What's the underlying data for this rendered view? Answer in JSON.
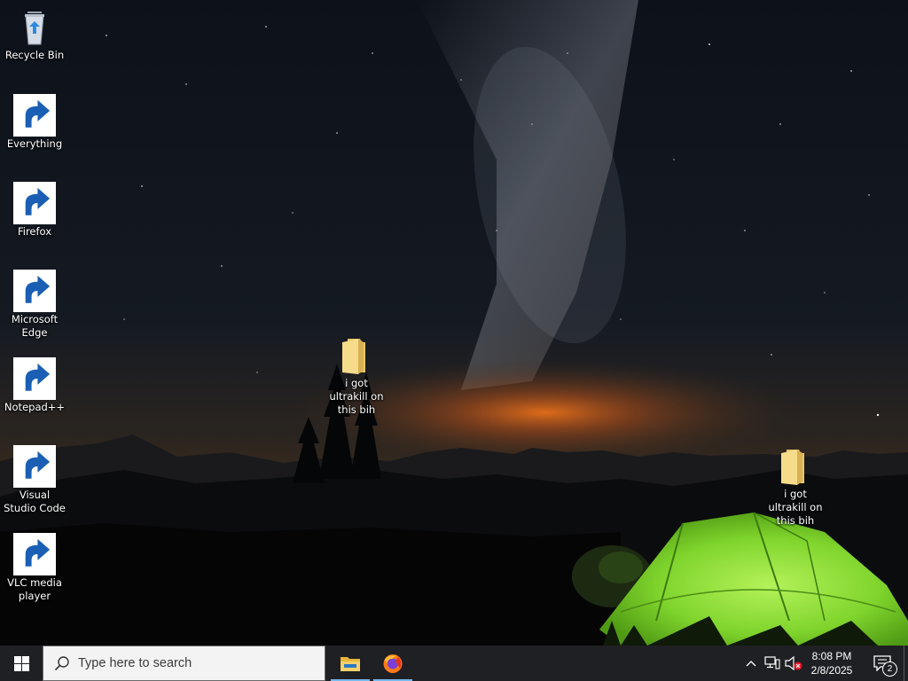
{
  "desktop": {
    "wallpaper": "night-sky-milky-way-glowing-green-tent",
    "icons": [
      {
        "id": "recycle-bin",
        "label": "Recycle Bin",
        "icon": "recycle-bin-icon",
        "shortcut": false
      },
      {
        "id": "everything",
        "label": "Everything",
        "icon": "everything-search-icon",
        "shortcut": true
      },
      {
        "id": "firefox",
        "label": "Firefox",
        "icon": "firefox-icon",
        "shortcut": true
      },
      {
        "id": "microsoft-edge",
        "label": "Microsoft Edge",
        "icon": "edge-icon",
        "shortcut": true
      },
      {
        "id": "notepad-plus-plus",
        "label": "Notepad++",
        "icon": "notepad-plus-plus-icon",
        "shortcut": true
      },
      {
        "id": "visual-studio-code",
        "label": "Visual Studio Code",
        "icon": "vscode-icon",
        "shortcut": true
      },
      {
        "id": "vlc",
        "label": "VLC media player",
        "icon": "vlc-icon",
        "shortcut": true
      }
    ],
    "folders": [
      {
        "id": "folder-1",
        "label": "i got ultrakill on this bih",
        "icon": "folder-icon"
      },
      {
        "id": "folder-2",
        "label": "i got ultrakill on this bih",
        "icon": "folder-icon"
      }
    ]
  },
  "taskbar": {
    "start_icon": "windows-logo-icon",
    "search_placeholder": "Type here to search",
    "pinned_apps": [
      {
        "id": "file-explorer",
        "icon": "file-explorer-icon",
        "running": true
      },
      {
        "id": "firefox",
        "icon": "firefox-icon",
        "running": true
      }
    ],
    "tray": {
      "icons": [
        "chevron-up-icon",
        "network-icon",
        "volume-muted-icon"
      ],
      "time": "8:08 PM",
      "date": "2/8/2025",
      "notification_count": "2"
    }
  },
  "colors": {
    "taskbar_bg": "#1f2024",
    "search_bg": "#f3f3f3",
    "accent_underline": "#76b9ed",
    "tent_green": "#8ee23a",
    "horizon_glow": "#d86a1c"
  }
}
